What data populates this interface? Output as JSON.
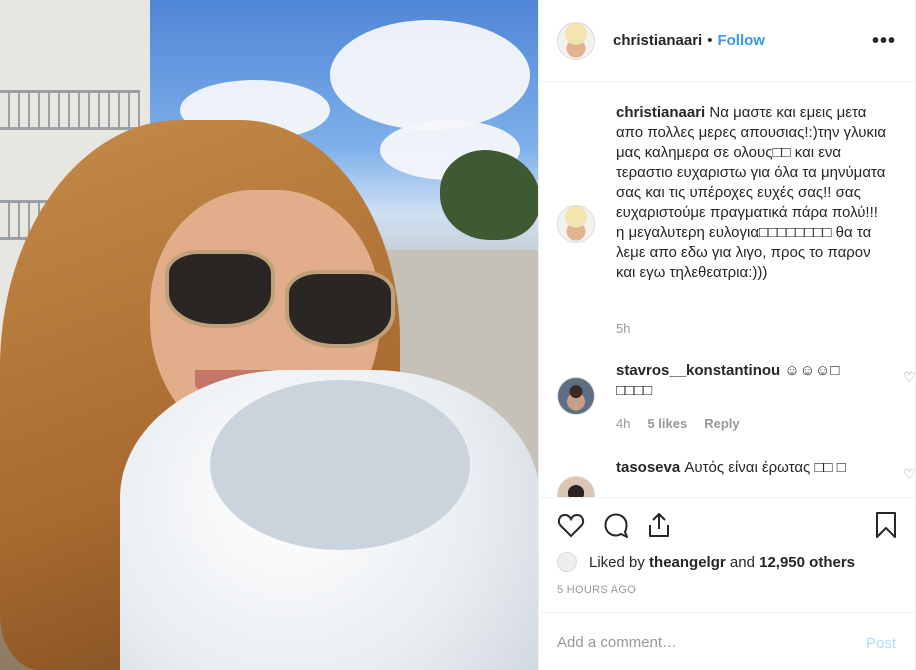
{
  "header": {
    "username": "christianaari",
    "separator": "•",
    "follow_label": "Follow",
    "more_label": "•••"
  },
  "caption": {
    "username": "christianaari",
    "text": "Να μαστε και εμεις μετα απο πολλες μερες απουσιας!:)την γλυκια μας καλημερα σε ολους□□ και ενα τεραστιο ευχαριστω για όλα τα μηνύματα σας και τις υπέροχες ευχές σας!! σας ευχαριστούμε πραγματικά πάρα πολύ!!!η μεγαλυτερη ευλογια□□□□□□□□ θα τα λεμε απο εδω για λιγο, προς το παρον και εγω τηλεθεατρια:)))",
    "time": "5h"
  },
  "comments": [
    {
      "username": "stavros__konstantinou",
      "text": "☺☺☺□ □□□□",
      "time": "4h",
      "likes": "5 likes",
      "reply": "Reply"
    },
    {
      "username": "tasoseva",
      "text": "Αυτός είναι έρωτας □□ □"
    }
  ],
  "likes": {
    "prefix": "Liked by",
    "user": "theangelgr",
    "conj": "and",
    "others": "12,950 others"
  },
  "posted_ago": "5 HOURS AGO",
  "add_comment": {
    "placeholder": "Add a comment…",
    "post_label": "Post"
  },
  "icons": {
    "like": "heart-icon",
    "comment": "comment-icon",
    "share": "share-icon",
    "save": "bookmark-icon"
  },
  "colors": {
    "link": "#3897f0",
    "muted": "#999999",
    "post_disabled": "#b2dffc"
  }
}
